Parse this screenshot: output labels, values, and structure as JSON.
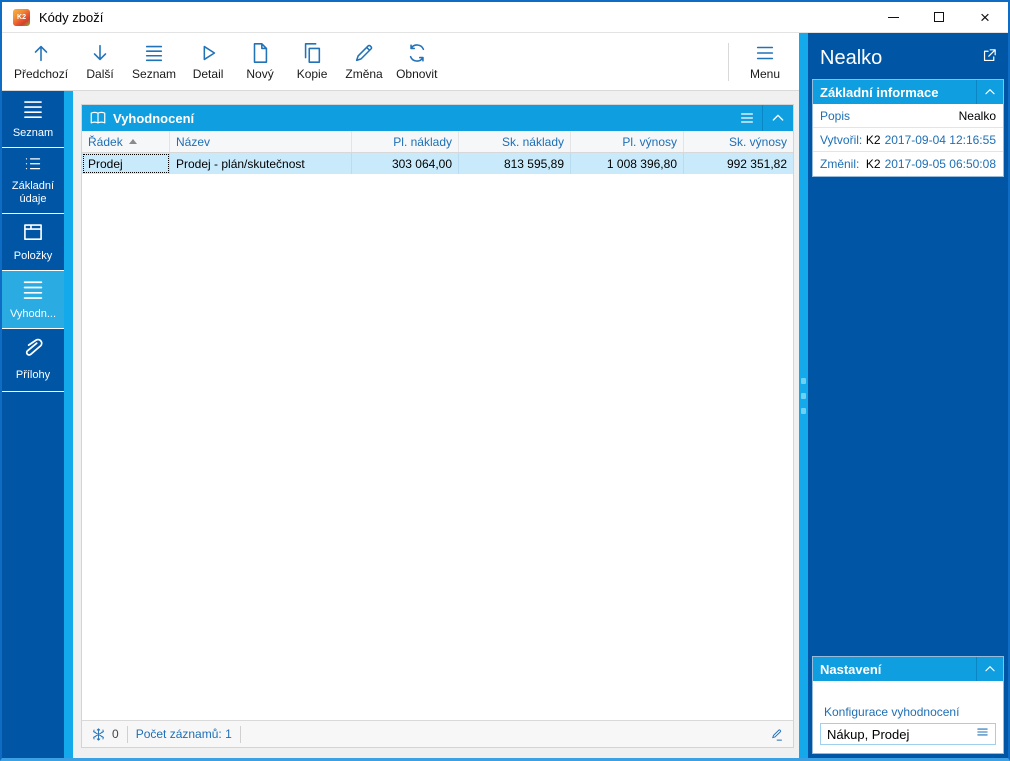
{
  "window": {
    "title": "Kódy zboží"
  },
  "toolbar": {
    "buttons": [
      {
        "label": "Předchozí",
        "icon": "arrow-up-icon"
      },
      {
        "label": "Další",
        "icon": "arrow-down-icon"
      },
      {
        "label": "Seznam",
        "icon": "list-lines-icon"
      },
      {
        "label": "Detail",
        "icon": "play-outline-icon"
      },
      {
        "label": "Nový",
        "icon": "new-document-icon"
      },
      {
        "label": "Kopie",
        "icon": "copy-icon"
      },
      {
        "label": "Změna",
        "icon": "pencil-icon"
      },
      {
        "label": "Obnovit",
        "icon": "refresh-icon"
      }
    ],
    "menu_label": "Menu"
  },
  "sidebar": {
    "items": [
      {
        "label": "Seznam",
        "icon": "list-lines-icon",
        "active": false
      },
      {
        "label": "Základní údaje",
        "icon": "detail-list-icon",
        "active": false
      },
      {
        "label": "Položky",
        "icon": "box-icon",
        "active": false
      },
      {
        "label": "Vyhodn...",
        "icon": "list-lines-icon",
        "active": true
      },
      {
        "label": "Přílohy",
        "icon": "paperclip-icon",
        "active": false
      }
    ]
  },
  "main": {
    "panel_title": "Vyhodnocení",
    "table": {
      "columns": [
        {
          "label": "Řádek",
          "sort": "asc",
          "align": "left"
        },
        {
          "label": "Název",
          "align": "left"
        },
        {
          "label": "Pl. náklady",
          "align": "right"
        },
        {
          "label": "Sk. náklady",
          "align": "right"
        },
        {
          "label": "Pl. výnosy",
          "align": "right"
        },
        {
          "label": "Sk. výnosy",
          "align": "right"
        }
      ],
      "rows": [
        [
          "Prodej",
          "Prodej - plán/skutečnost",
          "303 064,00",
          "813 595,89",
          "1 008 396,80",
          "992 351,82"
        ]
      ],
      "selected_row_index": 0
    },
    "statusbar": {
      "lock_count": "0",
      "records_label": "Počet záznamů: 1"
    }
  },
  "right_panel": {
    "title": "Nealko",
    "basic_info": {
      "title": "Základní informace",
      "rows": [
        {
          "label": "Popis",
          "value": "Nealko"
        },
        {
          "label": "Vytvořil:",
          "user": "K2",
          "date": "2017-09-04 12:16:55"
        },
        {
          "label": "Změnil:",
          "user": "K2",
          "date": "2017-09-05 06:50:08"
        }
      ]
    },
    "settings": {
      "title": "Nastavení",
      "field_label": "Konfigurace vyhodnocení",
      "field_value": "Nákup, Prodej"
    }
  },
  "colors": {
    "dark_blue": "#0055a5",
    "bright_blue_header": "#0f9fe0",
    "cyan_strip": "#14a9ea",
    "active_item_blue": "#2aace3",
    "selected_row": "#c9eafb",
    "blue_text": "#1e6fb5",
    "icon_blue": "#2272b8",
    "window_border": "#0f6cc4"
  }
}
